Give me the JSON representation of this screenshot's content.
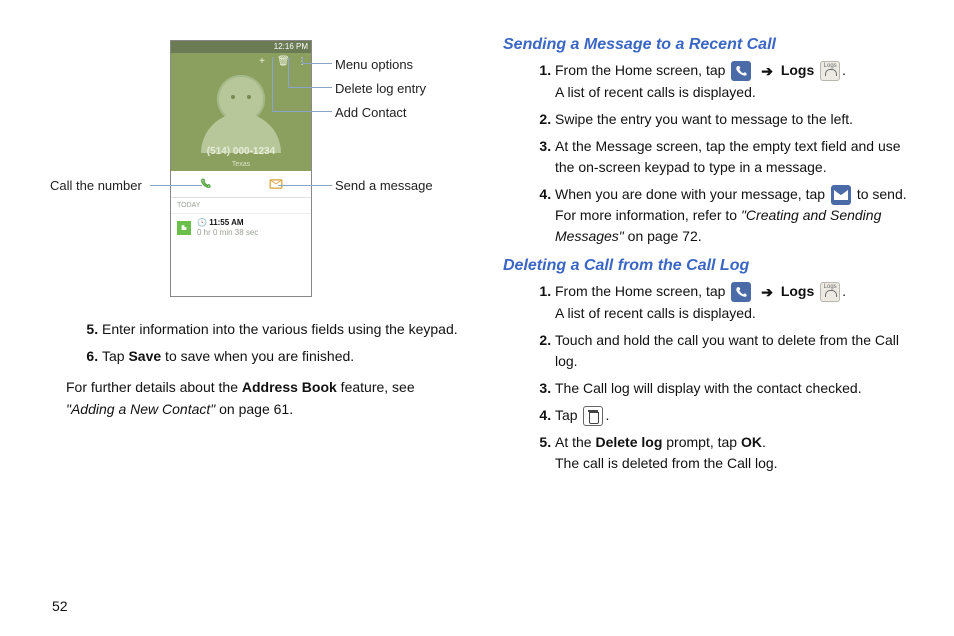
{
  "left": {
    "phone": {
      "status_time": "12:16 PM",
      "phone_number": "(514) 000-1234",
      "phone_sub": "Texas",
      "today_label": "TODAY",
      "log_time": "11:55 AM",
      "log_duration": "0 hr 0 min 38 sec"
    },
    "labels": {
      "menu_options": "Menu options",
      "delete_log_entry": "Delete log entry",
      "add_contact": "Add Contact",
      "call_the_number": "Call the number",
      "send_a_message": "Send a message"
    },
    "step5": "Enter information into the various fields using the keypad.",
    "step6_a": "Tap ",
    "step6_save": "Save",
    "step6_b": " to save when you are finished.",
    "details_a": "For further details about the ",
    "details_bold": "Address Book",
    "details_b": " feature, see ",
    "details_ref": "\"Adding a New Contact\"",
    "details_c": " on page 61."
  },
  "right": {
    "heading_send": "Sending a Message to a Recent Call",
    "send": {
      "s1_a": "From the Home screen, tap ",
      "s1_arrow": "➔",
      "s1_logs": "Logs",
      "s1_b": ".",
      "s1_c": "A list of recent calls is displayed.",
      "s2": "Swipe the entry you want to message to the left.",
      "s3": "At the Message screen, tap the empty text field and use the on-screen keypad to type in a message.",
      "s4_a": "When you are done with your message, tap ",
      "s4_b": " to send.",
      "s4_c": "For more information, refer to ",
      "s4_ref": "\"Creating and Sending Messages\"",
      "s4_d": "  on page 72."
    },
    "heading_del": "Deleting a Call from the Call Log",
    "del": {
      "s1_a": "From the Home screen, tap ",
      "s1_arrow": "➔",
      "s1_logs": "Logs",
      "s1_b": ".",
      "s1_c": "A list of recent calls is displayed.",
      "s2": "Touch and hold the call you want to delete from the Call log.",
      "s3": "The Call log will display with the contact checked.",
      "s4_a": "Tap ",
      "s4_b": ".",
      "s5_a": "At the ",
      "s5_bold": "Delete log",
      "s5_b": " prompt, tap ",
      "s5_ok": "OK",
      "s5_c": ".",
      "s5_d": "The call is deleted from the Call log."
    }
  },
  "page_number": "52"
}
